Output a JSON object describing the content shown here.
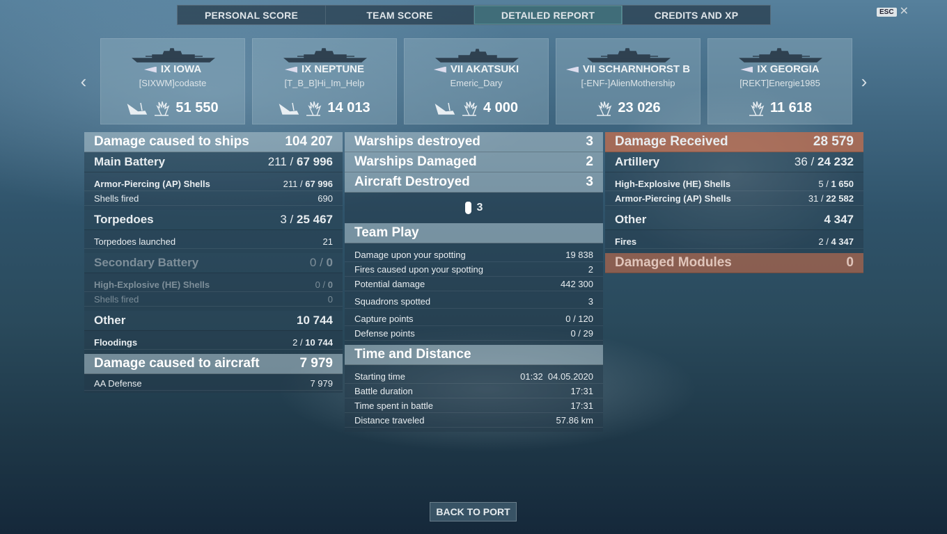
{
  "tabs": [
    "PERSONAL SCORE",
    "TEAM SCORE",
    "DETAILED REPORT",
    "CREDITS AND XP"
  ],
  "esc": "ESC",
  "cards": [
    {
      "tier_name": "IX IOWA",
      "player": "[SIXWM]codaste",
      "damage": "51 550"
    },
    {
      "tier_name": "IX NEPTUNE",
      "player": "[T_B_B]Hi_Im_Help",
      "damage": "14 013"
    },
    {
      "tier_name": "VII AKATSUKI",
      "player": "Emeric_Dary",
      "damage": "4 000"
    },
    {
      "tier_name": "VII SCHARNHORST B",
      "player": "[-ENF-]AlienMothership",
      "damage": "23 026"
    },
    {
      "tier_name": "IX GEORGIA",
      "player": "[REKT]Energie1985",
      "damage": "11 618"
    }
  ],
  "left": {
    "ships": {
      "label": "Damage caused to ships",
      "value": "104 207"
    },
    "main": {
      "label": "Main Battery",
      "hits": "211 /",
      "dmg": "67 996"
    },
    "ap": {
      "label": "Armor-Piercing (AP) Shells",
      "hits": "211 /",
      "dmg": "67 996"
    },
    "shells": {
      "label": "Shells fired",
      "value": "690"
    },
    "torp": {
      "label": "Torpedoes",
      "hits": "3 /",
      "dmg": "25 467"
    },
    "torp_launched": {
      "label": "Torpedoes launched",
      "value": "21"
    },
    "secondary": {
      "label": "Secondary Battery",
      "hits": "0 /",
      "dmg": "0"
    },
    "sec_he": {
      "label": "High-Explosive (HE) Shells",
      "hits": "0 /",
      "dmg": "0"
    },
    "sec_shells": {
      "label": "Shells fired",
      "value": "0"
    },
    "other": {
      "label": "Other",
      "value": "10 744"
    },
    "flood": {
      "label": "Floodings",
      "hits": "2 /",
      "dmg": "10 744"
    },
    "aircraft": {
      "label": "Damage caused to aircraft",
      "value": "7 979"
    },
    "aa": {
      "label": "AA Defense",
      "value": "7 979"
    }
  },
  "mid": {
    "destroyed": {
      "label": "Warships destroyed",
      "value": "3"
    },
    "damaged": {
      "label": "Warships Damaged",
      "value": "2"
    },
    "aircraft": {
      "label": "Aircraft Destroyed",
      "value": "3"
    },
    "bomb_count": "3",
    "teamplay": "Team Play",
    "tp_rows": [
      {
        "label": "Damage upon your spotting",
        "value": "19 838"
      },
      {
        "label": "Fires caused upon your spotting",
        "value": "2"
      },
      {
        "label": "Potential damage",
        "value": "442 300"
      },
      {
        "label": "Squadrons spotted",
        "value": "3"
      },
      {
        "label": "Capture points",
        "value": "0 / 120"
      },
      {
        "label": "Defense points",
        "value": "0 / 29"
      }
    ],
    "time": "Time and Distance",
    "td_rows": [
      {
        "label": "Starting time",
        "value": "01:32  04.05.2020"
      },
      {
        "label": "Battle duration",
        "value": "17:31"
      },
      {
        "label": "Time spent in battle",
        "value": "17:31"
      },
      {
        "label": "Distance traveled",
        "value": "57.86 km"
      }
    ]
  },
  "right": {
    "received": {
      "label": "Damage Received",
      "value": "28 579"
    },
    "artillery": {
      "label": "Artillery",
      "hits": "36 /",
      "dmg": "24 232"
    },
    "he": {
      "label": "High-Explosive (HE) Shells",
      "hits": "5 /",
      "dmg": "1 650"
    },
    "ap": {
      "label": "Armor-Piercing (AP) Shells",
      "hits": "31 /",
      "dmg": "22 582"
    },
    "other": {
      "label": "Other",
      "value": "4 347"
    },
    "fires": {
      "label": "Fires",
      "hits": "2 /",
      "dmg": "4 347"
    },
    "modules": {
      "label": "Damaged Modules",
      "value": "0"
    }
  },
  "back": "BACK TO PORT"
}
